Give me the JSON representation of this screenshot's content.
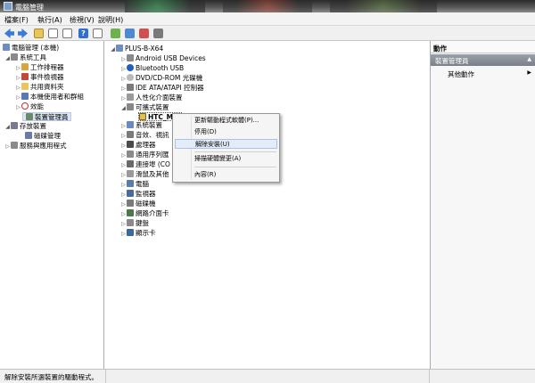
{
  "window": {
    "title": "電腦管理"
  },
  "menu": [
    "檔案(F)",
    "執行(A)",
    "檢視(V)",
    "說明(H)"
  ],
  "colors": {
    "selected_bg": "#dde6f3",
    "actions_band": "#8a9098",
    "titlebar": "#3a3a3a"
  },
  "left_tree": {
    "root": "電腦管理 (本機)",
    "system_tools": "系統工具",
    "items": [
      "工作排程器",
      "事件檢視器",
      "共用資料夾",
      "本機使用者和群組",
      "效能",
      "裝置管理員"
    ],
    "storage": "存放裝置",
    "disk_mgmt": "磁碟管理",
    "services": "服務與應用程式"
  },
  "device_tree": {
    "root": "PLUS-B-X64",
    "groups": [
      "Android USB Devices",
      "Bluetooth USB",
      "DVD/CD-ROM 光碟機",
      "IDE ATA/ATAPI 控制器",
      "人性化介面裝置",
      "可攜式裝置"
    ],
    "portable_child": "HTC_MC",
    "groups_after": [
      "系統裝置",
      "音效、視訊",
      "處理器",
      "通用序列匯",
      "連接埠 (CO",
      "滑鼠及其他",
      "電腦",
      "監視器",
      "磁碟機",
      "網路介面卡",
      "鍵盤",
      "顯示卡"
    ]
  },
  "context_menu": {
    "items": [
      "更新驅動程式軟體(P)...",
      "停用(D)",
      "解除安裝(U)",
      "掃描硬體變更(A)",
      "內容(R)"
    ],
    "highlighted": "解除安裝(U)"
  },
  "actions_pane": {
    "header": "動作",
    "section": "裝置管理員",
    "item": "其他動作"
  },
  "status": {
    "text": "解除安裝所選裝置的驅動程式。"
  }
}
